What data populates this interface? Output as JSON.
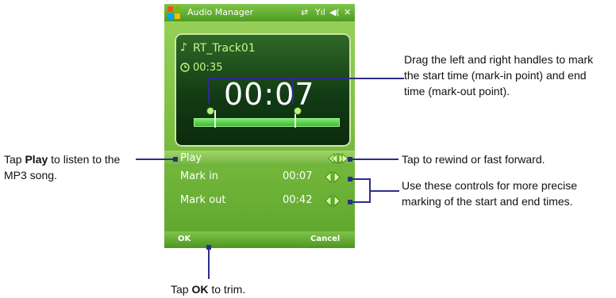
{
  "app": {
    "title": "Audio Manager",
    "status_icons": [
      "sync-icon",
      "signal-icon",
      "volume-icon",
      "close-icon"
    ],
    "close_glyph": "✕",
    "sync_glyph": "⇄",
    "signal_glyph": "Yıl",
    "volume_glyph": "◀("
  },
  "track": {
    "name": "RT_Track01",
    "duration": "00:35",
    "current": "00:07"
  },
  "play_bar": {
    "label": "Play"
  },
  "marks": [
    {
      "label": "Mark in",
      "time": "00:07"
    },
    {
      "label": "Mark out",
      "time": "00:42"
    }
  ],
  "softkeys": {
    "left": "OK",
    "right": "Cancel"
  },
  "callouts": {
    "handles": "Drag the left and right handles to mark the start time (mark-in point) and end time (mark-out point).",
    "rewind": "Tap to rewind or fast forward.",
    "controls": "Use these controls for more precise marking of the start and end times.",
    "play_prefix": "Tap ",
    "play_bold": "Play",
    "play_suffix": " to listen to the MP3 song.",
    "ok_prefix": "Tap ",
    "ok_bold": "OK",
    "ok_suffix": " to trim."
  },
  "colors": {
    "accent_green": "#6cb23a",
    "panel_dark": "#123b14",
    "callout_line": "#2d2d8a"
  }
}
